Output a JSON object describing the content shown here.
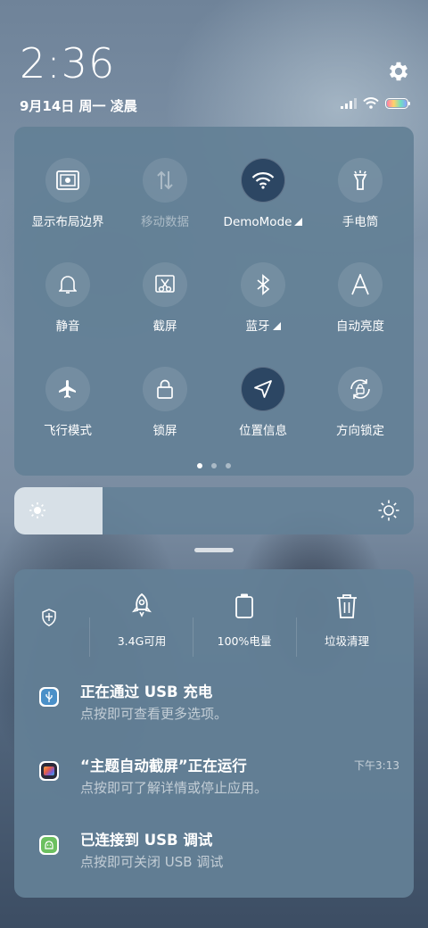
{
  "status": {
    "time": "2:36",
    "date": "9月14日 周一 凌晨"
  },
  "icons": {
    "settings": "gear-icon",
    "signal": "signal-icon",
    "wifi": "wifi-icon",
    "battery": "battery-icon"
  },
  "quick_settings": {
    "tiles": [
      {
        "label": "显示布局边界",
        "icon": "layout-bounds-icon",
        "active": false
      },
      {
        "label": "移动数据",
        "icon": "mobile-data-icon",
        "active": false,
        "disabled": true
      },
      {
        "label": "DemoMode",
        "icon": "wifi-icon",
        "active": true,
        "expandable": true
      },
      {
        "label": "手电筒",
        "icon": "flashlight-icon",
        "active": false
      },
      {
        "label": "静音",
        "icon": "bell-icon",
        "active": false
      },
      {
        "label": "截屏",
        "icon": "screenshot-icon",
        "active": false
      },
      {
        "label": "蓝牙",
        "icon": "bluetooth-icon",
        "active": false,
        "expandable": true
      },
      {
        "label": "自动亮度",
        "icon": "auto-brightness-icon",
        "active": false
      },
      {
        "label": "飞行模式",
        "icon": "airplane-icon",
        "active": false
      },
      {
        "label": "锁屏",
        "icon": "lock-icon",
        "active": false
      },
      {
        "label": "位置信息",
        "icon": "location-icon",
        "active": true
      },
      {
        "label": "方向锁定",
        "icon": "rotation-lock-icon",
        "active": false
      }
    ],
    "page_count": 3,
    "current_page": 1
  },
  "brightness": {
    "level": 0.22
  },
  "tools": [
    {
      "label": "",
      "icon": "security-shield-icon"
    },
    {
      "label": "3.4G可用",
      "icon": "rocket-icon"
    },
    {
      "label": "100%电量",
      "icon": "battery-icon"
    },
    {
      "label": "垃圾清理",
      "icon": "trash-icon"
    }
  ],
  "notifications": [
    {
      "title": "正在通过 USB 充电",
      "subtitle": "点按即可查看更多选项。",
      "time": "",
      "icon": "usb-icon",
      "icon_color": "#4a90c8"
    },
    {
      "title": "“主题自动截屏”正在运行",
      "subtitle": "点按即可了解详情或停止应用。",
      "time": "下午3:13",
      "icon": "app-theme-icon",
      "icon_color": "#2a2a3a"
    },
    {
      "title": "已连接到 USB 调试",
      "subtitle": "点按即可关闭 USB 调试",
      "time": "",
      "icon": "android-debug-icon",
      "icon_color": "#6cc060"
    }
  ]
}
